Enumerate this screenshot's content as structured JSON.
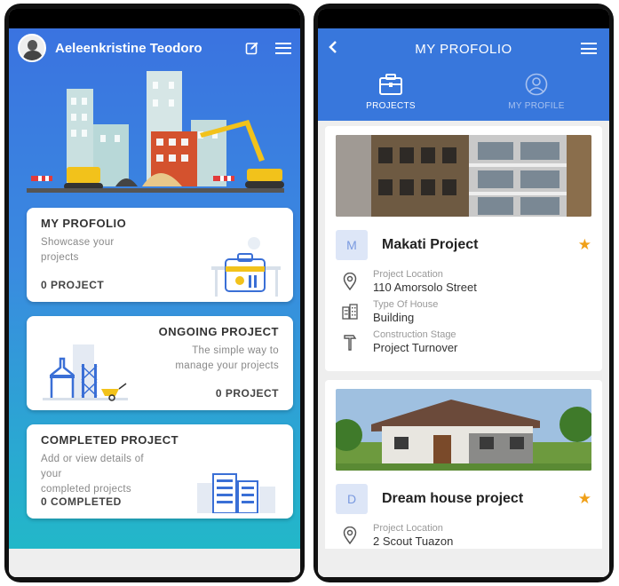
{
  "home": {
    "user_name": "Aeleenkristine Teodoro",
    "cards": {
      "portfolio": {
        "title": "MY PROFOLIO",
        "desc_line1": "Showcase your",
        "desc_line2": "projects",
        "count": "0 PROJECT"
      },
      "ongoing": {
        "title": "ONGOING PROJECT",
        "desc_line1": "The simple way to",
        "desc_line2": "manage your projects",
        "count": "0 PROJECT"
      },
      "completed": {
        "title": "COMPLETED PROJECT",
        "desc_line1": "Add or view details of",
        "desc_line2": "your",
        "desc_line3": "completed projects",
        "count": "0 COMPLETED"
      }
    }
  },
  "portfolio": {
    "title": "MY PROFOLIO",
    "tabs": [
      {
        "label": "PROJECTS",
        "icon": "briefcase-icon",
        "active": true
      },
      {
        "label": "MY PROFILE",
        "icon": "user-circle-icon",
        "active": false
      }
    ],
    "projects": [
      {
        "letter": "M",
        "name": "Makati Project",
        "location_label": "Project Location",
        "location": "110 Amorsolo Street",
        "type_label": "Type Of House",
        "type": "Building",
        "stage_label": "Construction Stage",
        "stage": "Project Turnover"
      },
      {
        "letter": "D",
        "name": "Dream house project",
        "location_label": "Project Location",
        "location": "2 Scout Tuazon"
      }
    ]
  },
  "colors": {
    "primary": "#3877dc",
    "star": "#f0a018",
    "badge_bg": "#dde6f7"
  }
}
